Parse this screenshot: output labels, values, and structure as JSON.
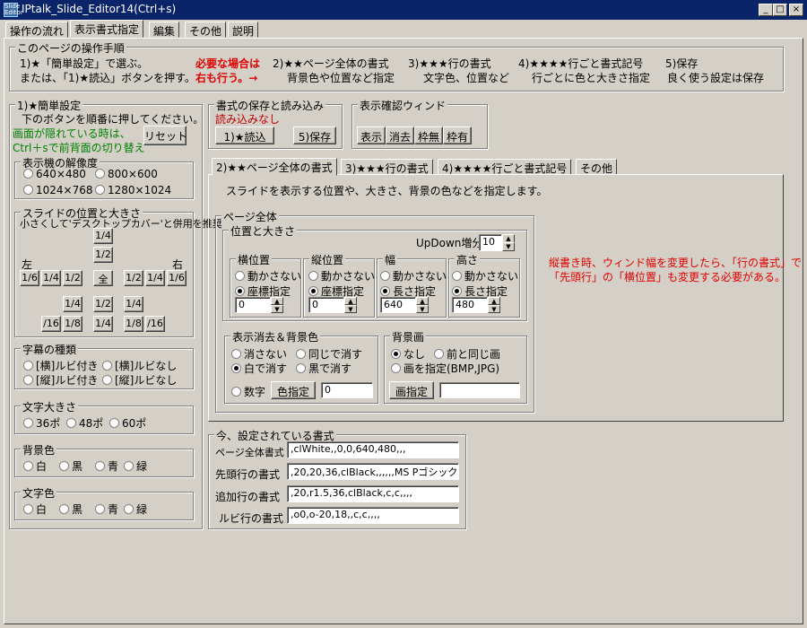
{
  "window": {
    "title": "IPtalk_Slide_Editor14(Ctrl+s)",
    "icon_text": "Slide Editor",
    "minimize": "_",
    "maximize": "□",
    "close": "×"
  },
  "top_tabs": [
    "操作の流れ",
    "表示書式指定",
    "編集",
    "その他",
    "説明"
  ],
  "procedure": {
    "label": "このページの操作手順",
    "line1": "1)★「簡単設定」で選ぶ。",
    "line2": "または、「1)★読込」ボタンを押す。",
    "required1": "必要な場合は",
    "required2": "右も行う。→",
    "step2_title": "2)★★ページ全体の書式",
    "step2_desc": "背景色や位置など指定",
    "step3_title": "3)★★★行の書式",
    "step3_desc": "文字色、位置など",
    "step4_title": "4)★★★★行ごと書式記号",
    "step4_desc": "行ごとに色と大きさ指定",
    "step5_title": "5)保存",
    "step5_desc": "良く使う設定は保存"
  },
  "simple": {
    "label": "1)★簡単設定",
    "instruction": "下のボタンを順番に押してください。",
    "hidden_note1": "画面が隠れている時は、",
    "hidden_note2": "Ctrl＋sで前背面の切り替え",
    "reset": "リセット",
    "resolution": {
      "label": "表示機の解像度",
      "options": [
        "640×480",
        "800×600",
        "1024×768",
        "1280×1024"
      ]
    },
    "slide": {
      "label": "スライドの位置と大きさ",
      "note": "小さくして'デスクトップカバー'と併用を推奨",
      "left": "左",
      "right": "右",
      "b_quarter": "1/4",
      "b_half": "1/2",
      "b_sixth": "1/6",
      "b_all": "全",
      "b_16": "/16",
      "b_18": "1/8"
    },
    "subtitle": {
      "label": "字幕の種類",
      "options": [
        "[横]ルビ付き",
        "[横]ルビなし",
        "[縦]ルビ付き",
        "[縦]ルビなし"
      ]
    },
    "textsize": {
      "label": "文字大きさ",
      "options": [
        "36ポ",
        "48ポ",
        "60ポ"
      ]
    },
    "bgcolor": {
      "label": "背景色",
      "options": [
        "白",
        "黒",
        "青",
        "緑"
      ]
    },
    "textcolor": {
      "label": "文字色",
      "options": [
        "白",
        "黒",
        "青",
        "緑"
      ]
    }
  },
  "saveload": {
    "label": "書式の保存と読み込み",
    "status": "読み込みなし",
    "load": "1)★読込",
    "save": "5)保存"
  },
  "preview": {
    "label": "表示確認ウィンド",
    "buttons": [
      "表示",
      "消去",
      "枠無",
      "枠有"
    ]
  },
  "inner_tabs": [
    "2)★★ページ全体の書式",
    "3)★★★行の書式",
    "4)★★★★行ごと書式記号",
    "その他"
  ],
  "page_settings": {
    "description": "スライドを表示する位置や、大きさ、背景の色などを指定します。",
    "whole_label": "ページ全体",
    "possize_label": "位置と大きさ",
    "updown_label": "UpDown増分",
    "updown_value": "10",
    "hpos": {
      "label": "横位置",
      "opt1": "動かさない",
      "opt2": "座標指定",
      "value": "0"
    },
    "vpos": {
      "label": "縦位置",
      "opt1": "動かさない",
      "opt2": "座標指定",
      "value": "0"
    },
    "width": {
      "label": "幅",
      "opt1": "動かさない",
      "opt2": "長さ指定",
      "value": "640"
    },
    "height": {
      "label": "高さ",
      "opt1": "動かさない",
      "opt2": "長さ指定",
      "value": "480"
    },
    "erase": {
      "label": "表示消去＆背景色",
      "opt1": "消さない",
      "opt2": "同じで消す",
      "opt3": "白で消す",
      "opt4": "黒で消す",
      "opt5": "数字",
      "color_btn": "色指定",
      "value": "0"
    },
    "bgimage": {
      "label": "背景画",
      "opt1": "なし",
      "opt2": "前と同じ画",
      "opt3": "画を指定(BMP,JPG)",
      "btn": "画指定",
      "value": ""
    },
    "note1": "縦書き時、ウィンド幅を変更したら、「行の書式」で",
    "note2": "「先頭行」の「横位置」も変更する必要がある。"
  },
  "current": {
    "label": "今、設定されている書式",
    "rows": [
      {
        "label": "ページ全体書式",
        "value": ",clWhite,,0,0,640,480,,,"
      },
      {
        "label": "先頭行の書式",
        "value": ",20,20,36,clBlack,,,,,,MS Pゴシック"
      },
      {
        "label": "追加行の書式",
        "value": ",20,r1.5,36,clBlack,c,c,,,,"
      },
      {
        "label": "ルビ行の書式",
        "value": ",o0,o-20,18,,c,c,,,,"
      }
    ]
  }
}
